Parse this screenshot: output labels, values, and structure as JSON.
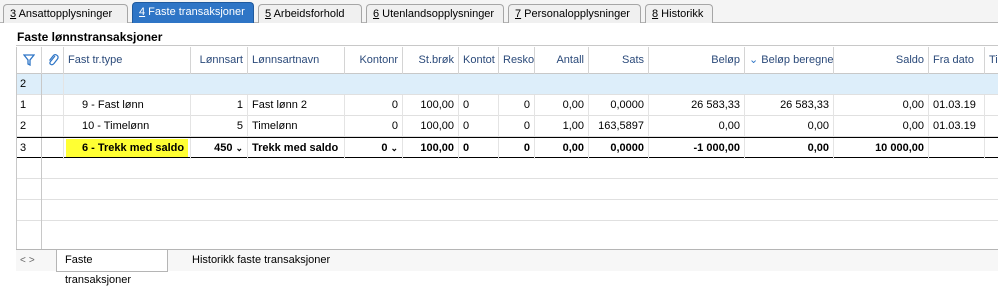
{
  "tabs": [
    {
      "key": "3",
      "rest": " Ansattopplysninger"
    },
    {
      "key": "4",
      "rest": " Faste transaksjoner"
    },
    {
      "key": "5",
      "rest": " Arbeidsforhold"
    },
    {
      "key": "6",
      "rest": " Utenlandsopplysninger"
    },
    {
      "key": "7",
      "rest": " Personalopplysninger"
    },
    {
      "key": "8",
      "rest": " Historikk"
    }
  ],
  "section_title": "Faste lønnstransaksjoner",
  "columns": {
    "fast_tr_type": "Fast tr.type",
    "lonnsart": "Lønnsart",
    "lonnsartnavn": "Lønnsartnavn",
    "kontonr": "Kontonr",
    "st_brok": "St.brøk",
    "kontot": "Kontot",
    "resko": "Resko",
    "antall": "Antall",
    "sats": "Sats",
    "belop": "Beløp",
    "belop_beregnet": "Beløp beregnet",
    "saldo": "Saldo",
    "fra_dato": "Fra dato",
    "ti": "Ti"
  },
  "rows": [
    {
      "num": "2"
    },
    {
      "num": "1",
      "type": "9 - Fast lønn",
      "lonnsart": "1",
      "navn": "Fast lønn 2",
      "kontonr": "0",
      "stbrok": "100,00",
      "kontot": "0",
      "resko": "0",
      "antall": "0,00",
      "sats": "0,0000",
      "belop": "26 583,33",
      "beregnet": "26 583,33",
      "saldo": "0,00",
      "fra": "01.03.19"
    },
    {
      "num": "2",
      "type": "10 - Timelønn",
      "lonnsart": "5",
      "navn": "Timelønn",
      "kontonr": "0",
      "stbrok": "100,00",
      "kontot": "0",
      "resko": "0",
      "antall": "1,00",
      "sats": "163,5897",
      "belop": "0,00",
      "beregnet": "0,00",
      "saldo": "0,00",
      "fra": "01.03.19"
    },
    {
      "num": "3",
      "type": "6 - Trekk med saldo",
      "lonnsart": "450",
      "navn": "Trekk med saldo",
      "kontonr": "0",
      "stbrok": "100,00",
      "kontot": "0",
      "resko": "0",
      "antall": "0,00",
      "sats": "0,0000",
      "belop": "-1 000,00",
      "beregnet": "0,00",
      "saldo": "10 000,00",
      "fra": ""
    }
  ],
  "bottom_tabs": [
    "Faste transaksjoner",
    "Historikk faste transaksjoner"
  ],
  "colors": {
    "active_tab": "#2e75c6",
    "highlight": "#ffff33",
    "blue_row": "#ddeefa"
  }
}
